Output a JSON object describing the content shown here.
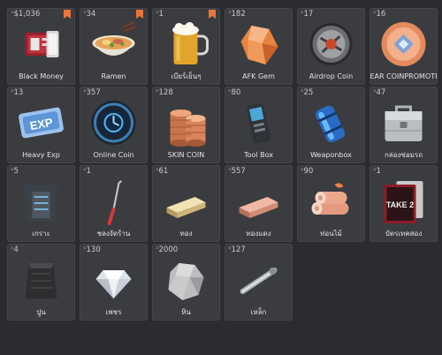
{
  "inventory": [
    {
      "label": "Black Money",
      "count": "$1,036",
      "bookmarked": true,
      "icon": "black-money-icon"
    },
    {
      "label": "Ramen",
      "count": "34",
      "bookmarked": true,
      "icon": "ramen-bowl-icon"
    },
    {
      "label": "เบียร์เย็นๆ",
      "count": "1",
      "bookmarked": true,
      "icon": "beer-mug-icon"
    },
    {
      "label": "AFK Gem",
      "count": "182",
      "bookmarked": false,
      "icon": "orange-gem-icon"
    },
    {
      "label": "Airdrop Coin",
      "count": "17",
      "bookmarked": false,
      "icon": "airdrop-coin-icon"
    },
    {
      "label": "EAR COINPROMOTI",
      "count": "16",
      "bookmarked": false,
      "icon": "promo-coin-icon"
    },
    {
      "label": "Heavy Exp",
      "count": "13",
      "bookmarked": false,
      "icon": "exp-ticket-icon"
    },
    {
      "label": "Online Coin",
      "count": "357",
      "bookmarked": false,
      "icon": "online-coin-icon"
    },
    {
      "label": "SKIN COIN",
      "count": "128",
      "bookmarked": false,
      "icon": "coin-stack-icon"
    },
    {
      "label": "Tool Box",
      "count": "80",
      "bookmarked": false,
      "icon": "scanner-device-icon"
    },
    {
      "label": "Weaponbox",
      "count": "25",
      "bookmarked": false,
      "icon": "blue-battery-icon"
    },
    {
      "label": "กล่องซ่อมรถ",
      "count": "47",
      "bookmarked": false,
      "icon": "repair-toolbox-icon"
    },
    {
      "label": "เกราะ",
      "count": "5",
      "bookmarked": false,
      "icon": "body-armor-icon"
    },
    {
      "label": "ชลงงัดร้าน",
      "count": "1",
      "bookmarked": false,
      "icon": "lockpick-icon"
    },
    {
      "label": "ทอง",
      "count": "61",
      "bookmarked": false,
      "icon": "gold-bar-icon"
    },
    {
      "label": "ทองแดง",
      "count": "557",
      "bookmarked": false,
      "icon": "copper-bar-icon"
    },
    {
      "label": "ท่อนไม้",
      "count": "90",
      "bookmarked": false,
      "icon": "wood-logs-icon"
    },
    {
      "label": "บัตรเทคสอง",
      "count": "1",
      "bookmarked": false,
      "icon": "take-two-card-icon"
    },
    {
      "label": "ปูน",
      "count": "4",
      "bookmarked": false,
      "icon": "cement-bag-icon"
    },
    {
      "label": "เพชร",
      "count": "130",
      "bookmarked": false,
      "icon": "diamond-icon"
    },
    {
      "label": "หิน",
      "count": "2000",
      "bookmarked": false,
      "icon": "stone-icon"
    },
    {
      "label": "เหล็ก",
      "count": "127",
      "bookmarked": false,
      "icon": "iron-rod-icon"
    }
  ],
  "tokens": {
    "exp_text": "EXP",
    "take_two_text": "TAKE 2"
  },
  "colors": {
    "background": "#2b2c2f",
    "slot": "#3b3c40",
    "bookmark": "#e8763a",
    "label": "#e4e4e6"
  }
}
